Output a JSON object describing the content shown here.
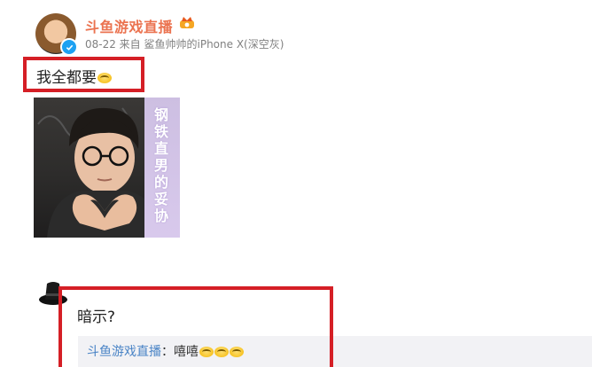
{
  "post": {
    "username": "斗鱼游戏直播",
    "meta": "08-22 来自 鲨鱼帅帅的iPhone X(深空灰)",
    "text": "我全都要",
    "image_caption": [
      "钢",
      "铁",
      "直",
      "男",
      "的",
      "妥",
      "协"
    ]
  },
  "comment": {
    "text": "暗示?",
    "reply_user": "斗鱼游戏直播",
    "reply_sep": "：",
    "reply_text": "嘻嘻"
  },
  "colors": {
    "username": "#eb7350",
    "highlight": "#d51f26",
    "link": "#4a84c6",
    "verify": "#1da1f2"
  }
}
